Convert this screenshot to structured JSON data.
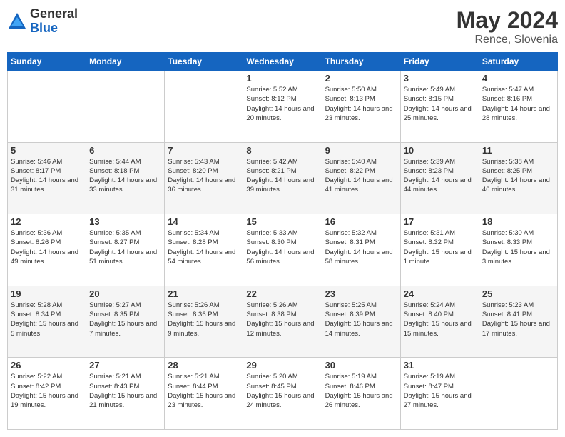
{
  "header": {
    "logo_general": "General",
    "logo_blue": "Blue",
    "title": "May 2024",
    "subtitle": "Rence, Slovenia"
  },
  "days_of_week": [
    "Sunday",
    "Monday",
    "Tuesday",
    "Wednesday",
    "Thursday",
    "Friday",
    "Saturday"
  ],
  "weeks": [
    [
      {
        "day": "",
        "sunrise": "",
        "sunset": "",
        "daylight": ""
      },
      {
        "day": "",
        "sunrise": "",
        "sunset": "",
        "daylight": ""
      },
      {
        "day": "",
        "sunrise": "",
        "sunset": "",
        "daylight": ""
      },
      {
        "day": "1",
        "sunrise": "Sunrise: 5:52 AM",
        "sunset": "Sunset: 8:12 PM",
        "daylight": "Daylight: 14 hours and 20 minutes."
      },
      {
        "day": "2",
        "sunrise": "Sunrise: 5:50 AM",
        "sunset": "Sunset: 8:13 PM",
        "daylight": "Daylight: 14 hours and 23 minutes."
      },
      {
        "day": "3",
        "sunrise": "Sunrise: 5:49 AM",
        "sunset": "Sunset: 8:15 PM",
        "daylight": "Daylight: 14 hours and 25 minutes."
      },
      {
        "day": "4",
        "sunrise": "Sunrise: 5:47 AM",
        "sunset": "Sunset: 8:16 PM",
        "daylight": "Daylight: 14 hours and 28 minutes."
      }
    ],
    [
      {
        "day": "5",
        "sunrise": "Sunrise: 5:46 AM",
        "sunset": "Sunset: 8:17 PM",
        "daylight": "Daylight: 14 hours and 31 minutes."
      },
      {
        "day": "6",
        "sunrise": "Sunrise: 5:44 AM",
        "sunset": "Sunset: 8:18 PM",
        "daylight": "Daylight: 14 hours and 33 minutes."
      },
      {
        "day": "7",
        "sunrise": "Sunrise: 5:43 AM",
        "sunset": "Sunset: 8:20 PM",
        "daylight": "Daylight: 14 hours and 36 minutes."
      },
      {
        "day": "8",
        "sunrise": "Sunrise: 5:42 AM",
        "sunset": "Sunset: 8:21 PM",
        "daylight": "Daylight: 14 hours and 39 minutes."
      },
      {
        "day": "9",
        "sunrise": "Sunrise: 5:40 AM",
        "sunset": "Sunset: 8:22 PM",
        "daylight": "Daylight: 14 hours and 41 minutes."
      },
      {
        "day": "10",
        "sunrise": "Sunrise: 5:39 AM",
        "sunset": "Sunset: 8:23 PM",
        "daylight": "Daylight: 14 hours and 44 minutes."
      },
      {
        "day": "11",
        "sunrise": "Sunrise: 5:38 AM",
        "sunset": "Sunset: 8:25 PM",
        "daylight": "Daylight: 14 hours and 46 minutes."
      }
    ],
    [
      {
        "day": "12",
        "sunrise": "Sunrise: 5:36 AM",
        "sunset": "Sunset: 8:26 PM",
        "daylight": "Daylight: 14 hours and 49 minutes."
      },
      {
        "day": "13",
        "sunrise": "Sunrise: 5:35 AM",
        "sunset": "Sunset: 8:27 PM",
        "daylight": "Daylight: 14 hours and 51 minutes."
      },
      {
        "day": "14",
        "sunrise": "Sunrise: 5:34 AM",
        "sunset": "Sunset: 8:28 PM",
        "daylight": "Daylight: 14 hours and 54 minutes."
      },
      {
        "day": "15",
        "sunrise": "Sunrise: 5:33 AM",
        "sunset": "Sunset: 8:30 PM",
        "daylight": "Daylight: 14 hours and 56 minutes."
      },
      {
        "day": "16",
        "sunrise": "Sunrise: 5:32 AM",
        "sunset": "Sunset: 8:31 PM",
        "daylight": "Daylight: 14 hours and 58 minutes."
      },
      {
        "day": "17",
        "sunrise": "Sunrise: 5:31 AM",
        "sunset": "Sunset: 8:32 PM",
        "daylight": "Daylight: 15 hours and 1 minute."
      },
      {
        "day": "18",
        "sunrise": "Sunrise: 5:30 AM",
        "sunset": "Sunset: 8:33 PM",
        "daylight": "Daylight: 15 hours and 3 minutes."
      }
    ],
    [
      {
        "day": "19",
        "sunrise": "Sunrise: 5:28 AM",
        "sunset": "Sunset: 8:34 PM",
        "daylight": "Daylight: 15 hours and 5 minutes."
      },
      {
        "day": "20",
        "sunrise": "Sunrise: 5:27 AM",
        "sunset": "Sunset: 8:35 PM",
        "daylight": "Daylight: 15 hours and 7 minutes."
      },
      {
        "day": "21",
        "sunrise": "Sunrise: 5:26 AM",
        "sunset": "Sunset: 8:36 PM",
        "daylight": "Daylight: 15 hours and 9 minutes."
      },
      {
        "day": "22",
        "sunrise": "Sunrise: 5:26 AM",
        "sunset": "Sunset: 8:38 PM",
        "daylight": "Daylight: 15 hours and 12 minutes."
      },
      {
        "day": "23",
        "sunrise": "Sunrise: 5:25 AM",
        "sunset": "Sunset: 8:39 PM",
        "daylight": "Daylight: 15 hours and 14 minutes."
      },
      {
        "day": "24",
        "sunrise": "Sunrise: 5:24 AM",
        "sunset": "Sunset: 8:40 PM",
        "daylight": "Daylight: 15 hours and 15 minutes."
      },
      {
        "day": "25",
        "sunrise": "Sunrise: 5:23 AM",
        "sunset": "Sunset: 8:41 PM",
        "daylight": "Daylight: 15 hours and 17 minutes."
      }
    ],
    [
      {
        "day": "26",
        "sunrise": "Sunrise: 5:22 AM",
        "sunset": "Sunset: 8:42 PM",
        "daylight": "Daylight: 15 hours and 19 minutes."
      },
      {
        "day": "27",
        "sunrise": "Sunrise: 5:21 AM",
        "sunset": "Sunset: 8:43 PM",
        "daylight": "Daylight: 15 hours and 21 minutes."
      },
      {
        "day": "28",
        "sunrise": "Sunrise: 5:21 AM",
        "sunset": "Sunset: 8:44 PM",
        "daylight": "Daylight: 15 hours and 23 minutes."
      },
      {
        "day": "29",
        "sunrise": "Sunrise: 5:20 AM",
        "sunset": "Sunset: 8:45 PM",
        "daylight": "Daylight: 15 hours and 24 minutes."
      },
      {
        "day": "30",
        "sunrise": "Sunrise: 5:19 AM",
        "sunset": "Sunset: 8:46 PM",
        "daylight": "Daylight: 15 hours and 26 minutes."
      },
      {
        "day": "31",
        "sunrise": "Sunrise: 5:19 AM",
        "sunset": "Sunset: 8:47 PM",
        "daylight": "Daylight: 15 hours and 27 minutes."
      },
      {
        "day": "",
        "sunrise": "",
        "sunset": "",
        "daylight": ""
      }
    ]
  ]
}
